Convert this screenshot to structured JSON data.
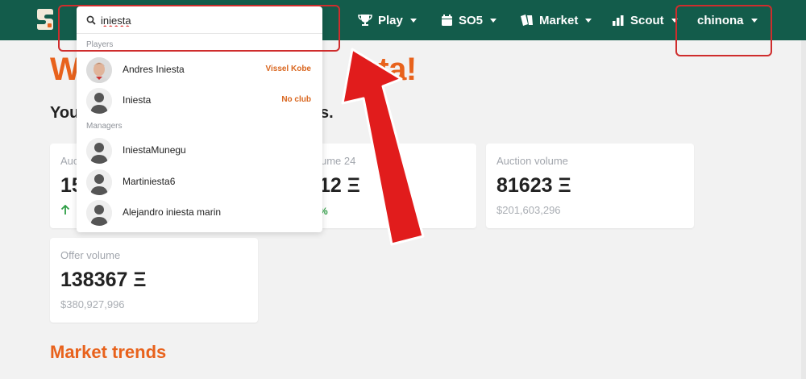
{
  "nav": {
    "logo_icon": "sorare-logo-icon",
    "items": [
      {
        "label": "Play",
        "icon": "trophy-icon"
      },
      {
        "label": "SO5",
        "icon": "calendar-icon"
      },
      {
        "label": "Market",
        "icon": "cards-icon"
      },
      {
        "label": "Scout",
        "icon": "bar-chart-icon"
      }
    ],
    "user": {
      "label": "chinona"
    }
  },
  "hero": {
    "visible_start": "W",
    "visible_end": "ta!"
  },
  "subhero": {
    "visible_start": "You",
    "visible_end": "ts."
  },
  "cards": [
    {
      "label": "Auc",
      "value": "15",
      "trend_icon": "arrow-up-icon"
    },
    {
      "label": "ume 24",
      "value": "12 Ξ",
      "trend": "%"
    },
    {
      "label": "Auction volume",
      "value": "81623 Ξ",
      "sub": "$201,603,296"
    },
    {
      "label": "Offer volume",
      "value": "138367 Ξ",
      "sub": "$380,927,996"
    }
  ],
  "section": {
    "title": "Market trends"
  },
  "search": {
    "value": "iniesta",
    "players_label": "Players",
    "managers_label": "Managers",
    "players": [
      {
        "name": "Andres Iniesta",
        "club": "Vissel Kobe"
      },
      {
        "name": "Iniesta",
        "club": "No club"
      }
    ],
    "managers": [
      {
        "name": "IniestaMunegu"
      },
      {
        "name": "Martiniesta6"
      },
      {
        "name": "Alejandro iniesta marin"
      }
    ]
  },
  "colors": {
    "nav_bg": "#135c4b",
    "accent_orange": "#e8621c",
    "annotation_red": "#cf2d2d",
    "trend_green": "#2e9e45"
  }
}
